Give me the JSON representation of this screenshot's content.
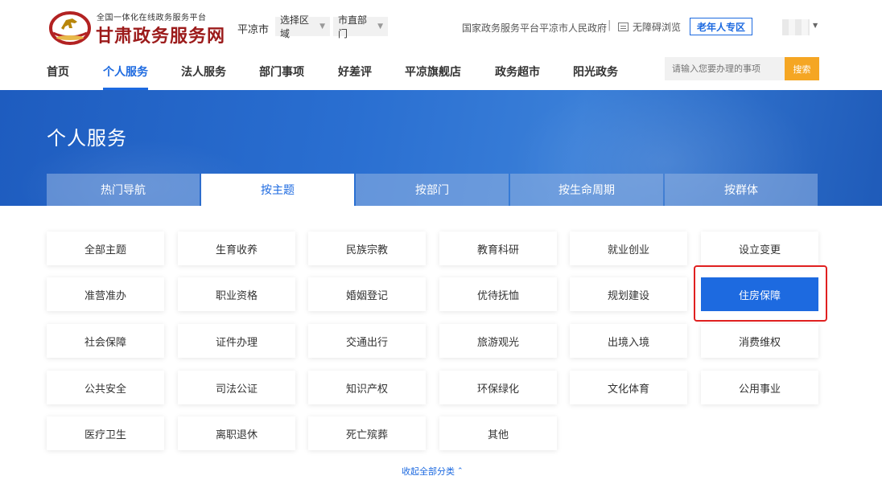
{
  "header": {
    "logo_subtitle": "全国一体化在线政务服务平台",
    "logo_title": "甘肃政务服务网",
    "city": "平凉市",
    "region_select": "选择区域",
    "dept_select": "市直部门",
    "links": {
      "national": "国家政务服务平台",
      "city_gov": "平凉市人民政府",
      "separator": "|",
      "accessible": "无障碍浏览"
    },
    "elder_zone": "老年人专区"
  },
  "nav": {
    "items": [
      {
        "label": "首页"
      },
      {
        "label": "个人服务",
        "active": true
      },
      {
        "label": "法人服务"
      },
      {
        "label": "部门事项"
      },
      {
        "label": "好差评"
      },
      {
        "label": "平凉旗舰店"
      },
      {
        "label": "政务超市"
      },
      {
        "label": "阳光政务"
      }
    ],
    "search_placeholder": "请输入您要办理的事项",
    "search_button": "搜索"
  },
  "banner": {
    "title": "个人服务",
    "tabs": [
      {
        "label": "热门导航"
      },
      {
        "label": "按主题",
        "active": true
      },
      {
        "label": "按部门"
      },
      {
        "label": "按生命周期"
      },
      {
        "label": "按群体"
      }
    ]
  },
  "topics": [
    "全部主题",
    "生育收养",
    "民族宗教",
    "教育科研",
    "就业创业",
    "设立变更",
    "准营准办",
    "职业资格",
    "婚姻登记",
    "优待抚恤",
    "规划建设",
    "住房保障",
    "社会保障",
    "证件办理",
    "交通出行",
    "旅游观光",
    "出境入境",
    "消费维权",
    "公共安全",
    "司法公证",
    "知识产权",
    "环保绿化",
    "文化体育",
    "公用事业",
    "医疗卫生",
    "离职退休",
    "死亡殡葬",
    "其他"
  ],
  "selected_topic": "住房保障",
  "collapse_label": "收起全部分类",
  "colors": {
    "accent": "#1d6ae0",
    "logo_red": "#9c1b1b",
    "search_button": "#f5a623",
    "highlight_border": "#e02020"
  },
  "icons": {
    "logo": "gansu-emblem-icon",
    "accessible": "monitor-icon",
    "dropdown": "caret-down-icon",
    "collapse": "chevron-up-icon"
  }
}
